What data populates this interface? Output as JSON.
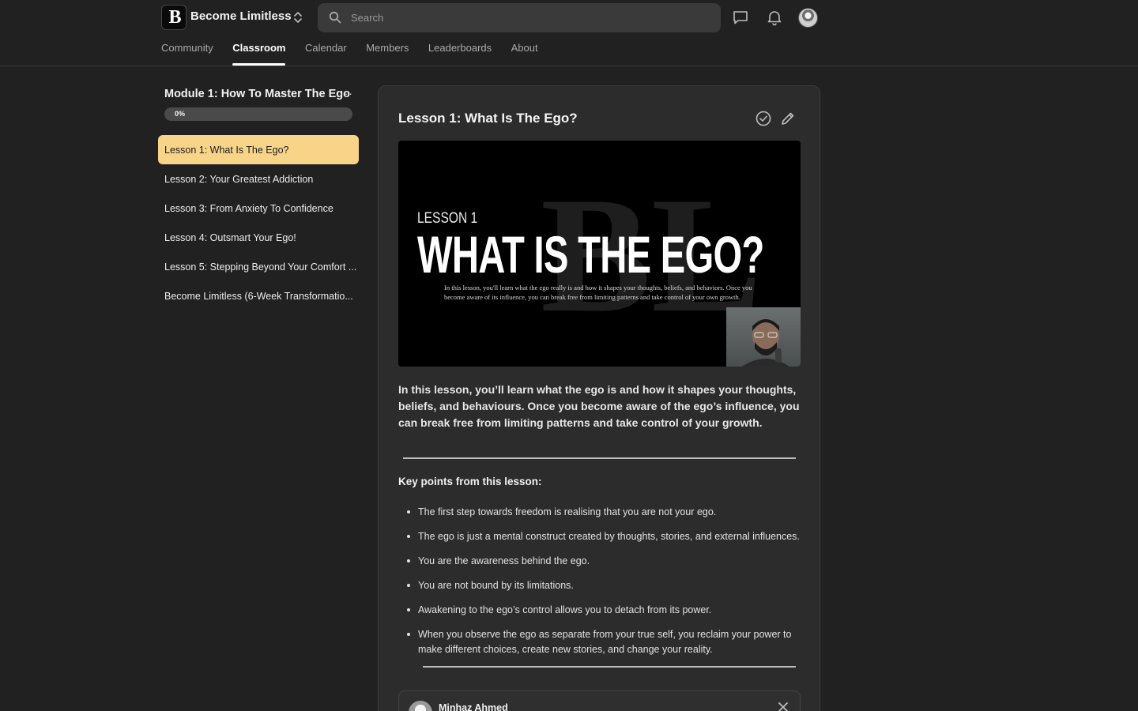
{
  "app": {
    "brand": "Become Limitless",
    "logo_letter": "B"
  },
  "search": {
    "placeholder": "Search"
  },
  "nav": {
    "tabs": [
      {
        "label": "Community",
        "active": false
      },
      {
        "label": "Classroom",
        "active": true
      },
      {
        "label": "Calendar",
        "active": false
      },
      {
        "label": "Members",
        "active": false
      },
      {
        "label": "Leaderboards",
        "active": false
      },
      {
        "label": "About",
        "active": false
      }
    ]
  },
  "module": {
    "title": "Module 1: How To Master The Ego",
    "more": "···",
    "progress_label": "0%",
    "progress": 0,
    "lessons": [
      {
        "label": "Lesson 1: What Is The Ego?",
        "active": true
      },
      {
        "label": "Lesson 2: Your Greatest Addiction",
        "active": false
      },
      {
        "label": "Lesson 3: From Anxiety To Confidence",
        "active": false
      },
      {
        "label": "Lesson 4: Outsmart Your Ego!",
        "active": false
      },
      {
        "label": "Lesson 5: Stepping Beyond Your Comfort ...",
        "active": false
      },
      {
        "label": "Become Limitless (6-Week Transformatio...",
        "active": false
      }
    ]
  },
  "lesson": {
    "title": "Lesson 1: What Is The Ego?",
    "video": {
      "kicker": "LESSON 1",
      "heading": "WHAT IS THE EGO?",
      "body": "In this lesson, you'll learn what the ego really is and how it shapes your thoughts, beliefs, and behaviors. Once you become aware of its influence, you can break free from limiting patterns and take control of your own growth.",
      "watermark": "BL"
    },
    "description": "In this lesson, you’ll learn what the ego is and how it shapes your thoughts, beliefs, and behaviours. Once you become aware of the ego’s influence, you can break free from limiting patterns and take control of your growth.",
    "key_heading": "Key points from this lesson:",
    "key_points": [
      "The first step towards freedom is realising that you are not your ego.",
      "The ego is just a mental construct created by thoughts, stories, and external influences.",
      "You are the awareness behind the ego.",
      "You are not bound by its limitations.",
      "Awakening to the ego’s control allows you to detach from its power.",
      "When you observe the ego as separate from your true self, you reclaim your power to make different choices, create new stories, and change your reality."
    ]
  },
  "comment": {
    "author": "Minhaz Ahmed"
  },
  "colors": {
    "background": "#212121",
    "card": "#2c2c2c",
    "active_lesson": "#f8d488",
    "text": "#e8e8e8"
  },
  "icons": {
    "search": "search-icon",
    "chat": "chat-icon",
    "bell": "bell-icon",
    "check": "check-circle-icon",
    "edit": "pencil-icon",
    "close": "close-icon",
    "switcher": "chevron-updown-icon"
  }
}
